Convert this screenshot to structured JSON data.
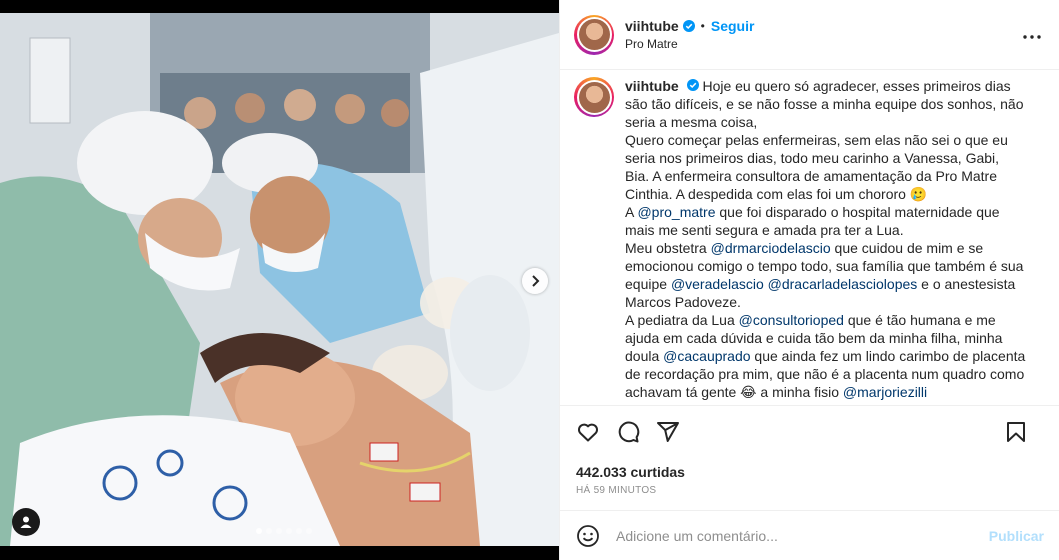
{
  "post": {
    "username": "viihtube",
    "follow_label": "Seguir",
    "location": "Pro Matre",
    "caption_segments": [
      {
        "type": "text",
        "text": "Hoje eu quero só agradecer, esses primeiros dias são tão difíceis, e se não fosse a minha equipe dos sonhos, não seria a mesma coisa,"
      },
      {
        "type": "br"
      },
      {
        "type": "text",
        "text": "Quero começar pelas enfermeiras, sem elas não sei o que eu seria nos primeiros dias, todo meu carinho a Vanessa, Gabi, Bia. A enfermeira consultora de amamentação da Pro Matre Cinthia. A despedida com elas foi um chororo 🥲"
      },
      {
        "type": "br"
      },
      {
        "type": "text",
        "text": "A "
      },
      {
        "type": "mention",
        "text": "@pro_matre"
      },
      {
        "type": "text",
        "text": " que foi disparado o hospital maternidade que mais me senti segura e amada pra ter a Lua."
      },
      {
        "type": "br"
      },
      {
        "type": "text",
        "text": "Meu obstetra "
      },
      {
        "type": "mention",
        "text": "@drmarciodelascio"
      },
      {
        "type": "text",
        "text": " que cuidou de mim e se emocionou comigo o tempo todo, sua família que também é sua equipe "
      },
      {
        "type": "mention",
        "text": "@veradelascio"
      },
      {
        "type": "text",
        "text": " "
      },
      {
        "type": "mention",
        "text": "@dracarladelasciolopes"
      },
      {
        "type": "text",
        "text": " e o anestesista Marcos Padoveze."
      },
      {
        "type": "br"
      },
      {
        "type": "text",
        "text": "A pediatra da Lua "
      },
      {
        "type": "mention",
        "text": "@consultorioped"
      },
      {
        "type": "text",
        "text": " que é tão humana e me ajuda em cada dúvida e cuida tão bem da minha filha, minha doula "
      },
      {
        "type": "mention",
        "text": "@cacauprado"
      },
      {
        "type": "text",
        "text": " que ainda fez um lindo carimbo de placenta de recordação pra mim, que não é a placenta num quadro como achavam tá gente 😂 a minha fisio "
      },
      {
        "type": "mention",
        "text": "@marjoriezilli"
      }
    ],
    "likes": "442.033 curtidas",
    "time_ago": "HÁ 59 MINUTOS"
  },
  "comment": {
    "placeholder": "Adicione um comentário...",
    "publish_label": "Publicar"
  },
  "carousel": {
    "slides": 6,
    "active_index": 0
  },
  "colors": {
    "link_blue": "#0095f6",
    "mention": "#00376b",
    "publish_disabled": "#b2dffc",
    "muted": "#8e8e8e"
  },
  "icons": [
    "verified-badge-icon",
    "more-options-icon",
    "heart-icon",
    "comment-icon",
    "share-icon",
    "bookmark-icon",
    "emoji-icon",
    "chevron-right-icon",
    "user-tag-icon"
  ]
}
